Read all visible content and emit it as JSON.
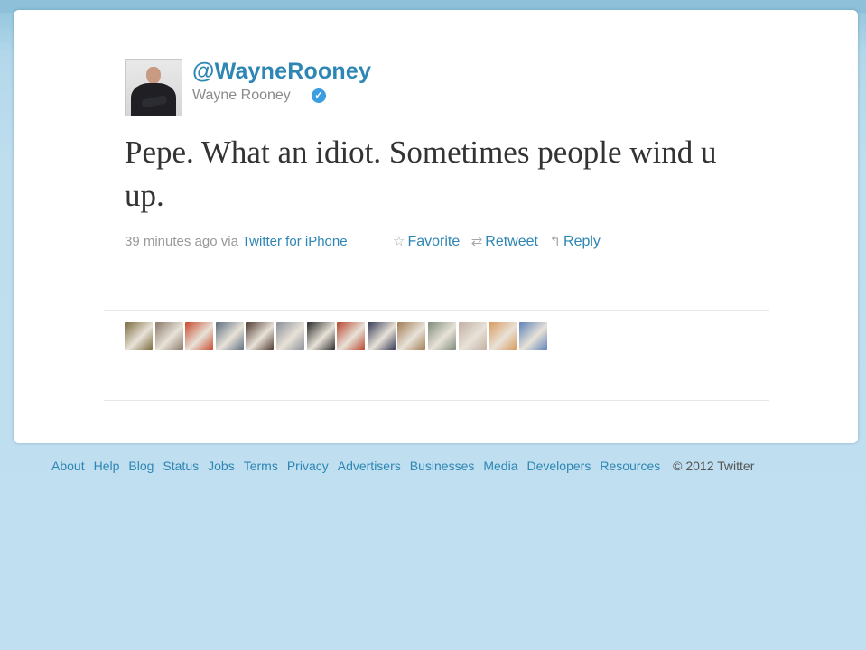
{
  "tweet": {
    "handle": "@WayneRooney",
    "display_name": "Wayne Rooney",
    "verified": true,
    "text": "Pepe. What an idiot. Sometimes people wind u up.",
    "time": "39 minutes ago",
    "via": "via",
    "source": "Twitter for iPhone",
    "actions": {
      "favorite": "Favorite",
      "retweet": "Retweet",
      "reply": "Reply"
    },
    "icons": {
      "favorite": "star-outline-icon",
      "retweet": "retweet-icon",
      "reply": "reply-arrow-icon",
      "verified": "verified-check-icon"
    }
  },
  "favoriters": {
    "count_thumbnails": 14,
    "thumb_colors": [
      "#7b6a3c",
      "#8a7a6a",
      "#c84a2c",
      "#5e6f80",
      "#4f3a30",
      "#8a9098",
      "#2c2c2c",
      "#b8452e",
      "#353a55",
      "#a07d55",
      "#7e8c7a",
      "#c2b0a2",
      "#d89a5c",
      "#5e82b8"
    ]
  },
  "footer": {
    "links": [
      "About",
      "Help",
      "Blog",
      "Status",
      "Jobs",
      "Terms",
      "Privacy",
      "Advertisers",
      "Businesses",
      "Media",
      "Developers",
      "Resources"
    ],
    "copyright": "© 2012 Twitter"
  },
  "colors": {
    "link": "#2d86b3",
    "background": "#c0dff0",
    "muted_text": "#999999"
  }
}
